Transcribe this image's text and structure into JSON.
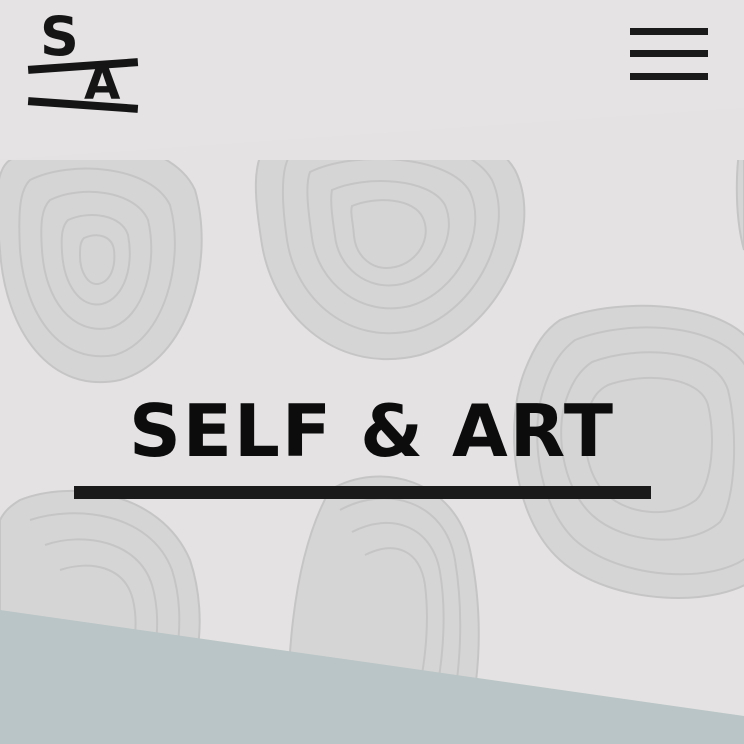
{
  "brand": {
    "logo_letter_top": "S",
    "logo_letter_bottom": "A"
  },
  "hero": {
    "title": "SELF & ART"
  },
  "colors": {
    "background": "#e4e2e2",
    "shape_fill": "#d5d4d4",
    "shape_rings": "#c7c6c6",
    "footer_band": "#b8c4c5",
    "text": "#0c0c0c"
  },
  "icons": {
    "menu": "hamburger-menu-icon"
  }
}
